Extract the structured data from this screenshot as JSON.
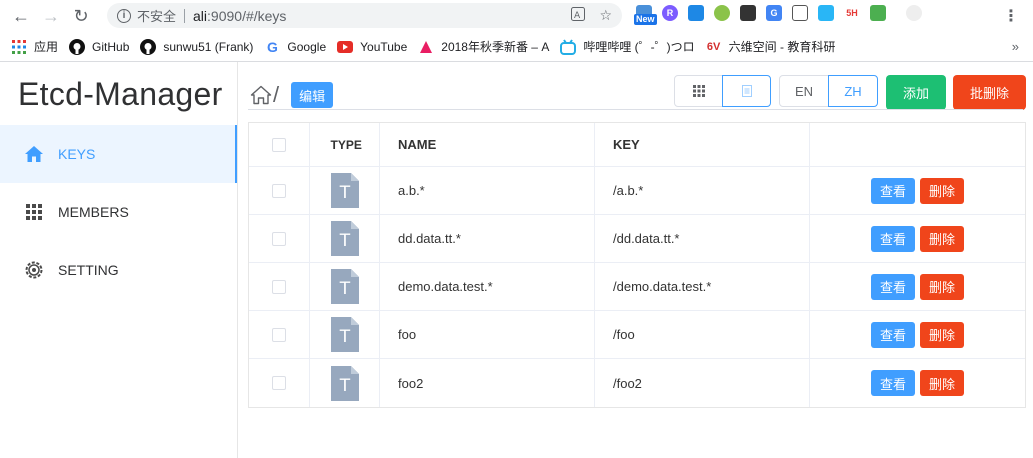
{
  "browser": {
    "insecure_label": "不安全",
    "url_host": "ali",
    "url_rest": ":9090/#/keys",
    "ext_badge": "New",
    "ext_sh": "5H",
    "bookmarks": [
      {
        "label": "应用",
        "icon": "apps-icon"
      },
      {
        "label": "GitHub",
        "icon": "github-icon"
      },
      {
        "label": "sunwu51 (Frank)",
        "icon": "github-icon"
      },
      {
        "label": "Google",
        "icon": "google-icon"
      },
      {
        "label": "YouTube",
        "icon": "youtube-icon"
      },
      {
        "label": "2018年秋季新番 – A",
        "icon": "anime-icon"
      },
      {
        "label": "哔哩哔哩 (゜-゜)つロ",
        "icon": "bilibili-icon"
      },
      {
        "label": "六维空间 - 教育科研",
        "icon": "sixd-icon"
      }
    ],
    "bookmarks_more": "»"
  },
  "sidebar": {
    "title": "Etcd-Manager",
    "items": [
      {
        "label": "KEYS",
        "icon": "home-icon",
        "active": true
      },
      {
        "label": "MEMBERS",
        "icon": "grid-icon",
        "active": false
      },
      {
        "label": "SETTING",
        "icon": "gear-icon",
        "active": false
      }
    ]
  },
  "toolbar": {
    "path": "/",
    "edit_label": "编辑",
    "lang_en": "EN",
    "lang_zh": "ZH",
    "add_label": "添加",
    "bulk_delete_label": "批删除",
    "active_view": "list",
    "active_lang": "ZH"
  },
  "table": {
    "headers": {
      "type": "TYPE",
      "name": "NAME",
      "key": "KEY"
    },
    "rows": [
      {
        "type": "T",
        "name": "a.b.*",
        "key": "/a.b.*",
        "view": "查看",
        "delete": "删除"
      },
      {
        "type": "T",
        "name": "dd.data.tt.*",
        "key": "/dd.data.tt.*",
        "view": "查看",
        "delete": "删除"
      },
      {
        "type": "T",
        "name": "demo.data.test.*",
        "key": "/demo.data.test.*",
        "view": "查看",
        "delete": "删除"
      },
      {
        "type": "T",
        "name": "foo",
        "key": "/foo",
        "view": "查看",
        "delete": "删除"
      },
      {
        "type": "T",
        "name": "foo2",
        "key": "/foo2",
        "view": "查看",
        "delete": "删除"
      }
    ]
  },
  "colors": {
    "primary": "#409eff",
    "success": "#1dbf73",
    "danger": "#f0451b",
    "file_icon": "#97a8be"
  }
}
